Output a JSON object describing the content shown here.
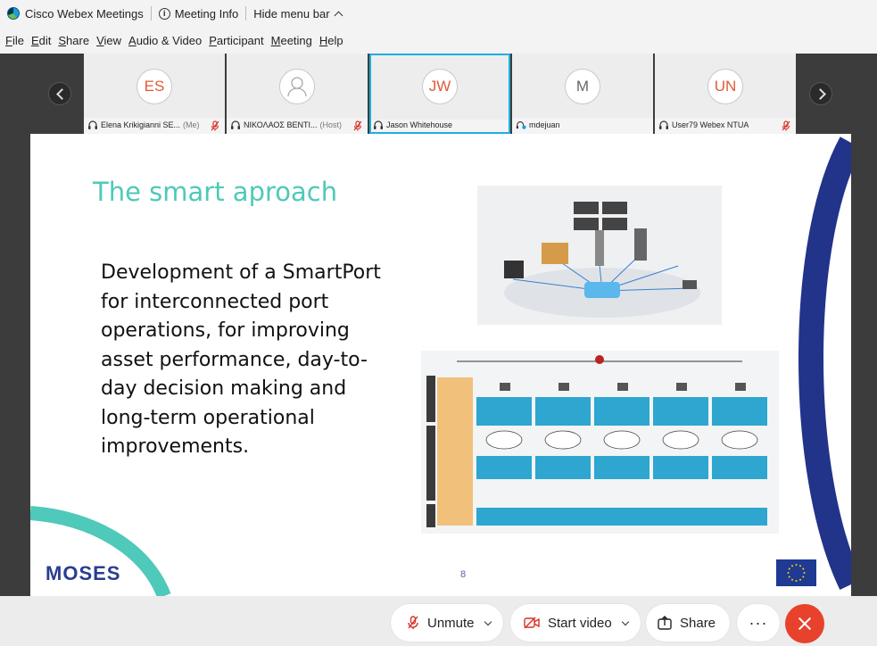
{
  "titlebar": {
    "app_name": "Cisco Webex Meetings",
    "meeting_info": "Meeting Info",
    "hide_menu": "Hide menu bar"
  },
  "menu": [
    {
      "hotkey": "F",
      "rest": "ile"
    },
    {
      "hotkey": "E",
      "rest": "dit"
    },
    {
      "hotkey": "S",
      "rest": "hare"
    },
    {
      "hotkey": "V",
      "rest": "iew"
    },
    {
      "hotkey": "A",
      "rest": "udio & Video"
    },
    {
      "hotkey": "P",
      "rest": "articipant"
    },
    {
      "hotkey": "M",
      "rest": "eeting"
    },
    {
      "hotkey": "H",
      "rest": "elp"
    }
  ],
  "participants": [
    {
      "initials": "ES",
      "name": "Elena Krikigianni SE...",
      "tag": "(Me)",
      "muted": true
    },
    {
      "initials": "",
      "name": "ΝΙΚΟΛΑΟΣ ΒΕΝΤΙ...",
      "tag": "(Host)",
      "muted": true
    },
    {
      "initials": "JW",
      "name": "Jason Whitehouse",
      "tag": "",
      "muted": false,
      "active": true
    },
    {
      "initials": "M",
      "name": "mdejuan",
      "tag": "",
      "muted": false
    },
    {
      "initials": "UN",
      "name": "User79 Webex NTUA",
      "tag": "",
      "muted": true
    }
  ],
  "slide": {
    "title": "The smart aproach",
    "body": "Development of a SmartPort for interconnected port operations, for improving asset performance, day-to-day decision making and long-term operational improvements.",
    "page_number": "8",
    "logo_text": "MOSES"
  },
  "controls": {
    "unmute": "Unmute",
    "start_video": "Start video",
    "share": "Share",
    "more": "···"
  },
  "colors": {
    "active_tile_border": "#1bb0e0",
    "slide_title": "#4fc9b9",
    "leave_button": "#e8412c",
    "muted_icon": "#d93025"
  }
}
